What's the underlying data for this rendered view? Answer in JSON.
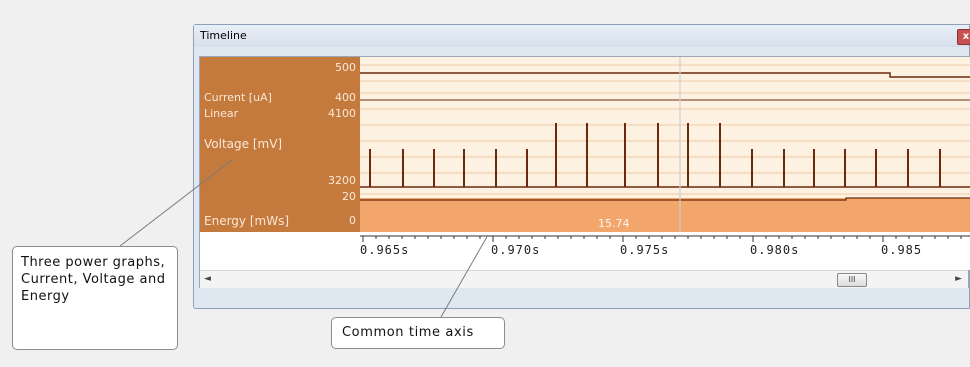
{
  "window": {
    "title": "Timeline",
    "close_glyph": "x"
  },
  "graphs": {
    "current": {
      "label": "Current [uA]",
      "max_tick": "500",
      "min_tick": "400"
    },
    "voltage": {
      "scale": "Linear",
      "label": "Voltage [mV]",
      "max_tick": "4100",
      "min_tick": "3200"
    },
    "energy": {
      "label": "Energy [mWs]",
      "max_tick": "20",
      "min_tick": "0",
      "value_readout": "15.74"
    }
  },
  "time_axis": {
    "ticks": [
      "0.965s",
      "0.970s",
      "0.975s",
      "0.980s",
      "0.985"
    ]
  },
  "scrollbar": {
    "left_arrow": "◄",
    "right_arrow": "►",
    "thumb_glyph": "III"
  },
  "annotations": {
    "power_graphs_note": "Three power graphs, Current, Voltage and Energy",
    "time_axis_note": "Common time axis"
  },
  "colors": {
    "label_panel": "#c47a3d",
    "graph_background": "#fdf2e2",
    "signal_line": "#6b2a0e",
    "energy_fill": "#f2a66b",
    "cursor_line": "#c8c8c8"
  }
}
